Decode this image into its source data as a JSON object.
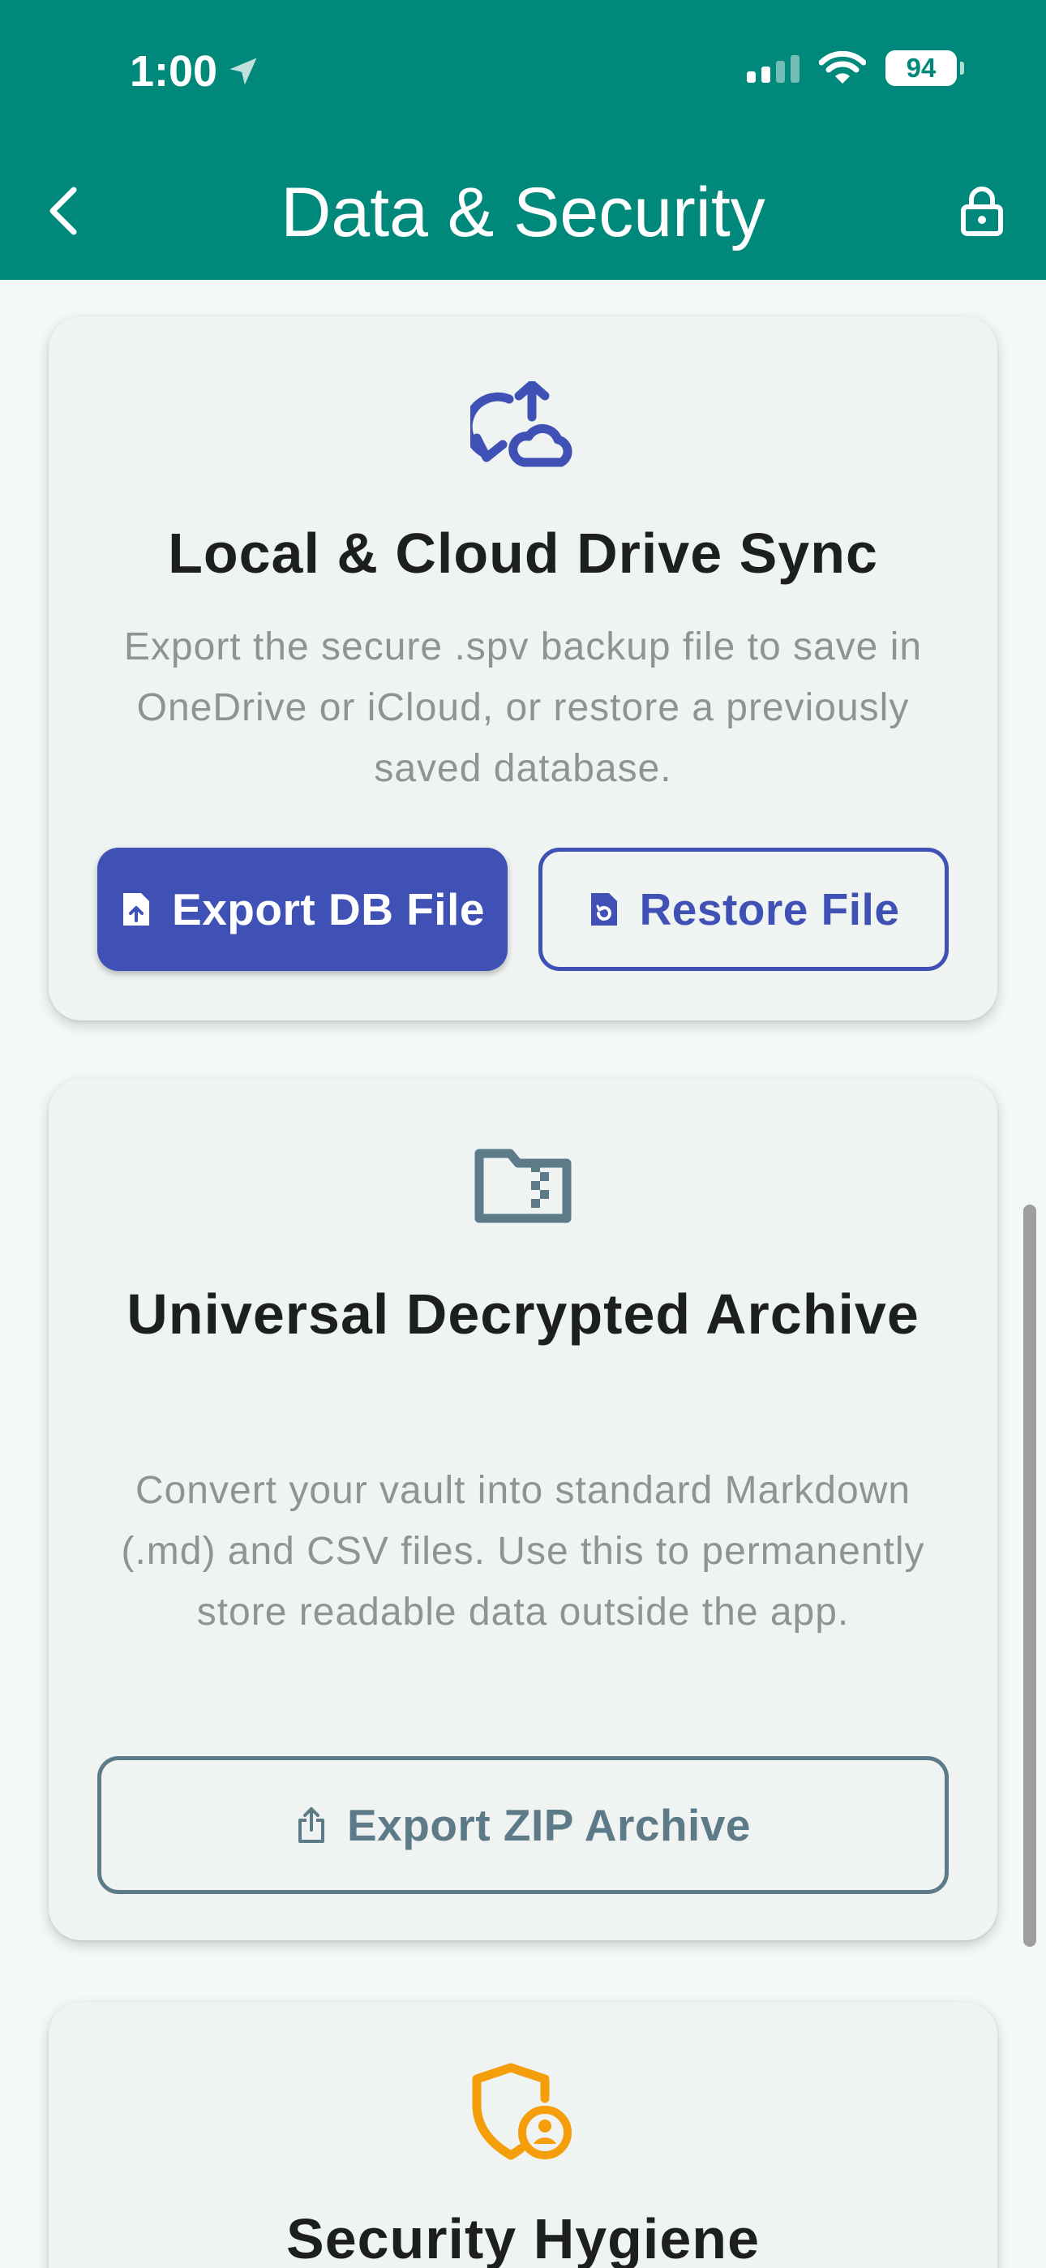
{
  "status_bar": {
    "time": "1:00",
    "battery": "94"
  },
  "nav": {
    "title": "Data & Security"
  },
  "sync_card": {
    "title": "Local & Cloud Drive Sync",
    "description": "Export the secure .spv backup file to save in OneDrive or iCloud, or restore a previously saved database.",
    "export_label": "Export DB File",
    "restore_label": "Restore File",
    "icon": "sync-cloud-icon"
  },
  "archive_card": {
    "title": "Universal Decrypted Archive",
    "description": "Convert your vault into standard Markdown (.md) and CSV files. Use this to permanently store readable data outside the app.",
    "export_label": "Export ZIP Archive",
    "icon": "folder-zip-icon"
  },
  "hygiene_card": {
    "title": "Security Hygiene",
    "icon": "shield-person-icon"
  },
  "colors": {
    "header": "#00897B",
    "primary": "#3F51B5",
    "archive": "#5D7A88",
    "hygiene": "#F59E0B",
    "background": "#F3F9F7"
  }
}
